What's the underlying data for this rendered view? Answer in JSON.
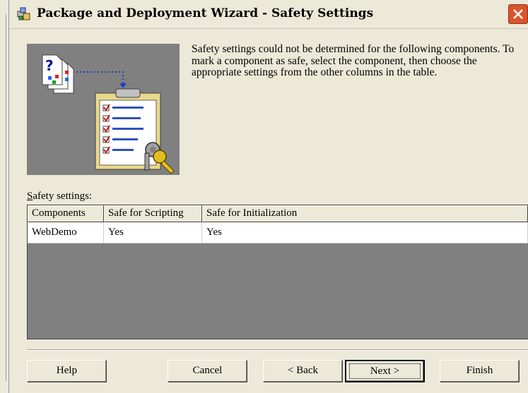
{
  "window": {
    "title": "Package and Deployment Wizard - Safety Settings"
  },
  "description": "Safety settings could not be determined for the following components. To mark a component as safe, select the component, then choose the appropriate settings from the other columns in the table.",
  "grid": {
    "label": "Safety settings:",
    "columns": [
      "Components",
      "Safe for Scripting",
      "Safe for Initialization"
    ],
    "rows": [
      [
        "WebDemo",
        "Yes",
        "Yes"
      ]
    ]
  },
  "buttons": {
    "help": "Help",
    "cancel": "Cancel",
    "back": "< Back",
    "next": "Next >",
    "finish": "Finish"
  }
}
